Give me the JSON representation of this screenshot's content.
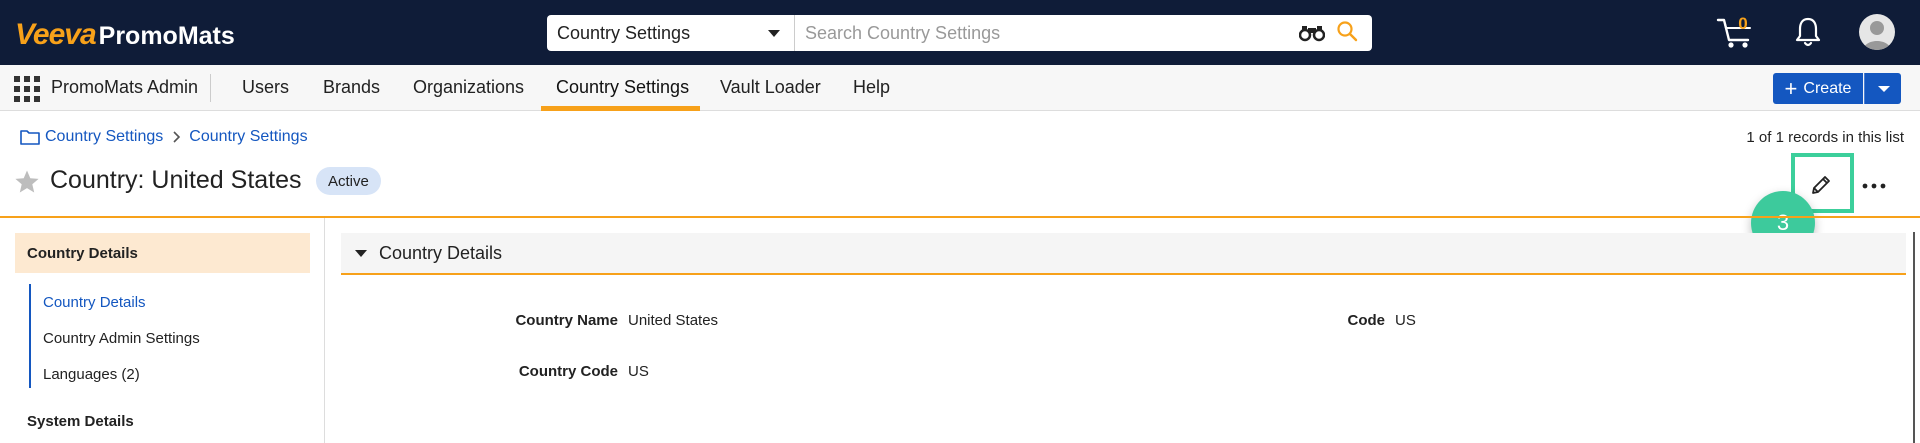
{
  "app": {
    "brand": "Veeva",
    "name": "PromoMats"
  },
  "search": {
    "scope": "Country Settings",
    "placeholder": "Search Country Settings"
  },
  "cart": {
    "count": "0"
  },
  "nav": {
    "admin_label": "PromoMats Admin",
    "tabs": [
      {
        "label": "Users"
      },
      {
        "label": "Brands"
      },
      {
        "label": "Organizations"
      },
      {
        "label": "Country Settings",
        "active": true
      },
      {
        "label": "Vault Loader"
      },
      {
        "label": "Help"
      }
    ],
    "create_label": "Create"
  },
  "breadcrumb": {
    "items": [
      "Country Settings",
      "Country Settings"
    ]
  },
  "record_count": "1 of 1 records in this list",
  "record": {
    "title": "Country: United States",
    "status": "Active"
  },
  "step_badge": "3",
  "left_panel": {
    "section": "Country Details",
    "links": [
      {
        "label": "Country Details",
        "active": true
      },
      {
        "label": "Country Admin Settings"
      },
      {
        "label": "Languages (2)"
      }
    ],
    "sub_section": "System Details"
  },
  "details": {
    "section_title": "Country Details",
    "fields": [
      {
        "label": "Country Name",
        "value": "United States"
      },
      {
        "label": "Code",
        "value": "US"
      },
      {
        "label": "Country Code",
        "value": "US"
      }
    ]
  },
  "colors": {
    "navy": "#0f1c38",
    "accent": "#f7a11a",
    "primary": "#1457c0",
    "highlight": "#3ccf9b"
  }
}
